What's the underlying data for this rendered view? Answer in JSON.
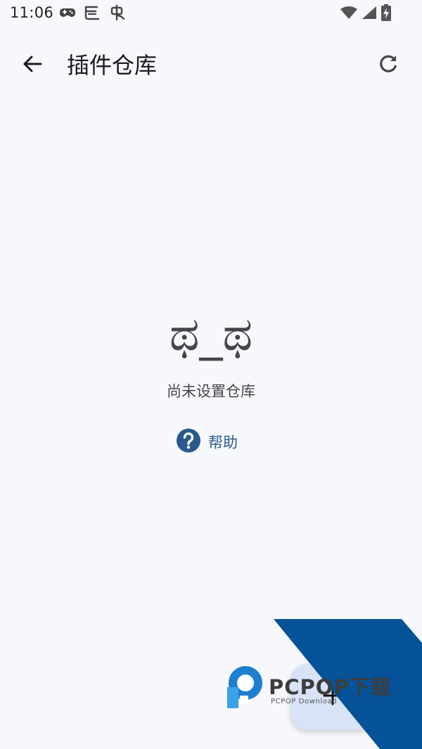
{
  "status_bar": {
    "time": "11:06",
    "left_icons": [
      "gamepad-icon",
      "notification-app-icon",
      "bug-app-icon"
    ],
    "right_icons": [
      "wifi-icon",
      "cellular-signal-icon",
      "battery-charging-icon"
    ]
  },
  "app_bar": {
    "title": "插件仓库",
    "back_icon": "arrow-back-icon",
    "refresh_icon": "refresh-icon"
  },
  "empty_state": {
    "face": "ಥ_ಥ",
    "message": "尚未设置仓库",
    "help_label": "帮助",
    "help_icon": "help-circle-icon"
  },
  "fab": {
    "icon": "add-icon"
  },
  "watermark": {
    "brand": "PCPOP下载",
    "sub": "PCPOP Download"
  },
  "colors": {
    "background": "#f7f8fc",
    "primary_text": "#1b1b1f",
    "secondary_text": "#45464c",
    "help_accent": "#2a5a8c",
    "fab_container": "#d8e3f8",
    "watermark_blue": "#004f96"
  }
}
